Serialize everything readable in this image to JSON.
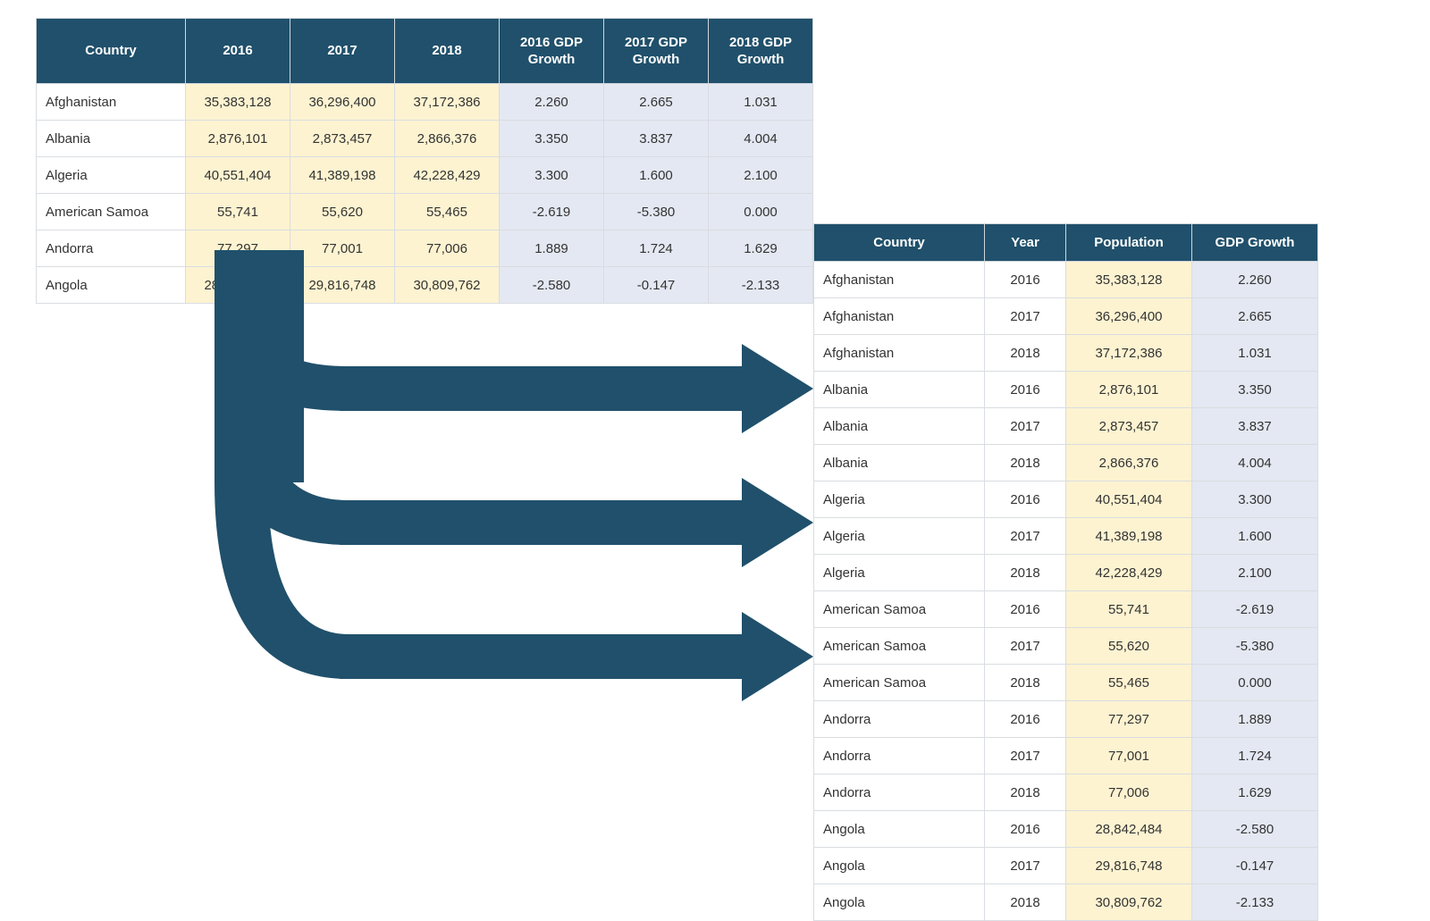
{
  "colors": {
    "header_bg": "#20506b",
    "pop_bg": "#fdf3d1",
    "gdp_bg": "#e4e8f2",
    "arrow": "#20506b"
  },
  "wide_table": {
    "headers": [
      "Country",
      "2016",
      "2017",
      "2018",
      "2016 GDP Growth",
      "2017 GDP Growth",
      "2018 GDP Growth"
    ],
    "rows": [
      {
        "country": "Afghanistan",
        "p2016": "35,383,128",
        "p2017": "36,296,400",
        "p2018": "37,172,386",
        "g2016": "2.260",
        "g2017": "2.665",
        "g2018": "1.031"
      },
      {
        "country": "Albania",
        "p2016": "2,876,101",
        "p2017": "2,873,457",
        "p2018": "2,866,376",
        "g2016": "3.350",
        "g2017": "3.837",
        "g2018": "4.004"
      },
      {
        "country": "Algeria",
        "p2016": "40,551,404",
        "p2017": "41,389,198",
        "p2018": "42,228,429",
        "g2016": "3.300",
        "g2017": "1.600",
        "g2018": "2.100"
      },
      {
        "country": "American Samoa",
        "p2016": "55,741",
        "p2017": "55,620",
        "p2018": "55,465",
        "g2016": "-2.619",
        "g2017": "-5.380",
        "g2018": "0.000"
      },
      {
        "country": "Andorra",
        "p2016": "77,297",
        "p2017": "77,001",
        "p2018": "77,006",
        "g2016": "1.889",
        "g2017": "1.724",
        "g2018": "1.629"
      },
      {
        "country": "Angola",
        "p2016": "28,842,484",
        "p2017": "29,816,748",
        "p2018": "30,809,762",
        "g2016": "-2.580",
        "g2017": "-0.147",
        "g2018": "-2.133"
      }
    ]
  },
  "long_table": {
    "headers": [
      "Country",
      "Year",
      "Population",
      "GDP Growth"
    ],
    "rows": [
      {
        "country": "Afghanistan",
        "year": "2016",
        "pop": "35,383,128",
        "gdp": "2.260"
      },
      {
        "country": "Afghanistan",
        "year": "2017",
        "pop": "36,296,400",
        "gdp": "2.665"
      },
      {
        "country": "Afghanistan",
        "year": "2018",
        "pop": "37,172,386",
        "gdp": "1.031"
      },
      {
        "country": "Albania",
        "year": "2016",
        "pop": "2,876,101",
        "gdp": "3.350"
      },
      {
        "country": "Albania",
        "year": "2017",
        "pop": "2,873,457",
        "gdp": "3.837"
      },
      {
        "country": "Albania",
        "year": "2018",
        "pop": "2,866,376",
        "gdp": "4.004"
      },
      {
        "country": "Algeria",
        "year": "2016",
        "pop": "40,551,404",
        "gdp": "3.300"
      },
      {
        "country": "Algeria",
        "year": "2017",
        "pop": "41,389,198",
        "gdp": "1.600"
      },
      {
        "country": "Algeria",
        "year": "2018",
        "pop": "42,228,429",
        "gdp": "2.100"
      },
      {
        "country": "American Samoa",
        "year": "2016",
        "pop": "55,741",
        "gdp": "-2.619"
      },
      {
        "country": "American Samoa",
        "year": "2017",
        "pop": "55,620",
        "gdp": "-5.380"
      },
      {
        "country": "American Samoa",
        "year": "2018",
        "pop": "55,465",
        "gdp": "0.000"
      },
      {
        "country": "Andorra",
        "year": "2016",
        "pop": "77,297",
        "gdp": "1.889"
      },
      {
        "country": "Andorra",
        "year": "2017",
        "pop": "77,001",
        "gdp": "1.724"
      },
      {
        "country": "Andorra",
        "year": "2018",
        "pop": "77,006",
        "gdp": "1.629"
      },
      {
        "country": "Angola",
        "year": "2016",
        "pop": "28,842,484",
        "gdp": "-2.580"
      },
      {
        "country": "Angola",
        "year": "2017",
        "pop": "29,816,748",
        "gdp": "-0.147"
      },
      {
        "country": "Angola",
        "year": "2018",
        "pop": "30,809,762",
        "gdp": "-2.133"
      }
    ]
  }
}
